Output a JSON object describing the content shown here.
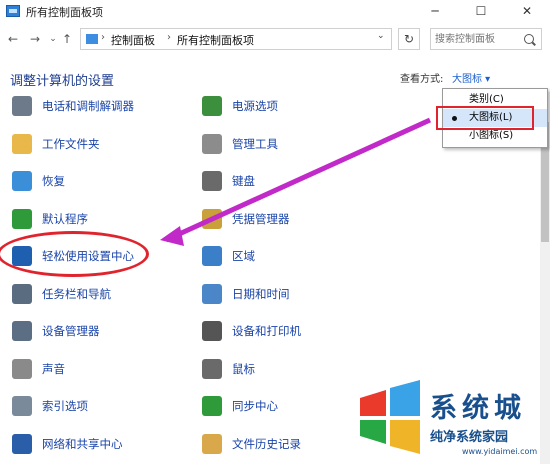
{
  "window": {
    "title": "所有控制面板项"
  },
  "window_controls": {
    "minimize": "─",
    "maximize": "☐",
    "close": "✕"
  },
  "nav": {
    "back": "←",
    "forward": "→",
    "recent": "⌄",
    "up": "↑"
  },
  "breadcrumb": [
    "控制面板",
    "所有控制面板项"
  ],
  "breadcrumb_sep": "›",
  "address_dropdown": "⌄",
  "refresh": "↻",
  "search": {
    "placeholder": "搜索控制面板"
  },
  "heading": "调整计算机的设置",
  "view": {
    "label": "查看方式:",
    "value": "大图标 ▾"
  },
  "view_menu": [
    {
      "label": "类别(C)",
      "selected": false
    },
    {
      "label": "大图标(L)",
      "selected": true
    },
    {
      "label": "小图标(S)",
      "selected": false
    }
  ],
  "items_left": [
    {
      "label": "电话和调制解调器",
      "icon": "phone-modem-icon",
      "color": "#6c7a89"
    },
    {
      "label": "工作文件夹",
      "icon": "work-folders-icon",
      "color": "#e8b84a"
    },
    {
      "label": "恢复",
      "icon": "recovery-icon",
      "color": "#3a8fd8"
    },
    {
      "label": "默认程序",
      "icon": "default-programs-icon",
      "color": "#2f9a3a"
    },
    {
      "label": "轻松使用设置中心",
      "icon": "ease-of-access-icon",
      "color": "#1f5fb0"
    },
    {
      "label": "任务栏和导航",
      "icon": "taskbar-icon",
      "color": "#5a6c80"
    },
    {
      "label": "设备管理器",
      "icon": "device-manager-icon",
      "color": "#5b6e84"
    },
    {
      "label": "声音",
      "icon": "sound-icon",
      "color": "#8a8a8a"
    },
    {
      "label": "索引选项",
      "icon": "indexing-icon",
      "color": "#7a8a9a"
    },
    {
      "label": "网络和共享中心",
      "icon": "network-sharing-icon",
      "color": "#2a5ea8"
    }
  ],
  "items_right": [
    {
      "label": "电源选项",
      "icon": "power-options-icon",
      "color": "#3c8f3c"
    },
    {
      "label": "管理工具",
      "icon": "admin-tools-icon",
      "color": "#8c8c8c"
    },
    {
      "label": "键盘",
      "icon": "keyboard-icon",
      "color": "#6a6a6a"
    },
    {
      "label": "凭据管理器",
      "icon": "credential-manager-icon",
      "color": "#c9a03a"
    },
    {
      "label": "区域",
      "icon": "region-icon",
      "color": "#3b7fc8"
    },
    {
      "label": "日期和时间",
      "icon": "date-time-icon",
      "color": "#4a86c8"
    },
    {
      "label": "设备和打印机",
      "icon": "devices-printers-icon",
      "color": "#555555"
    },
    {
      "label": "鼠标",
      "icon": "mouse-icon",
      "color": "#6a6a6a"
    },
    {
      "label": "同步中心",
      "icon": "sync-center-icon",
      "color": "#2f9a3a"
    },
    {
      "label": "文件历史记录",
      "icon": "file-history-icon",
      "color": "#d8a84a"
    }
  ],
  "watermark": {
    "title": "系统城",
    "line": "纯净系统家园",
    "url": "www.yidaimei.com"
  },
  "colors": {
    "link": "#1a44a8",
    "heading": "#1e3d8f",
    "annotation": "#e0242e",
    "arrow": "#c229c9"
  }
}
